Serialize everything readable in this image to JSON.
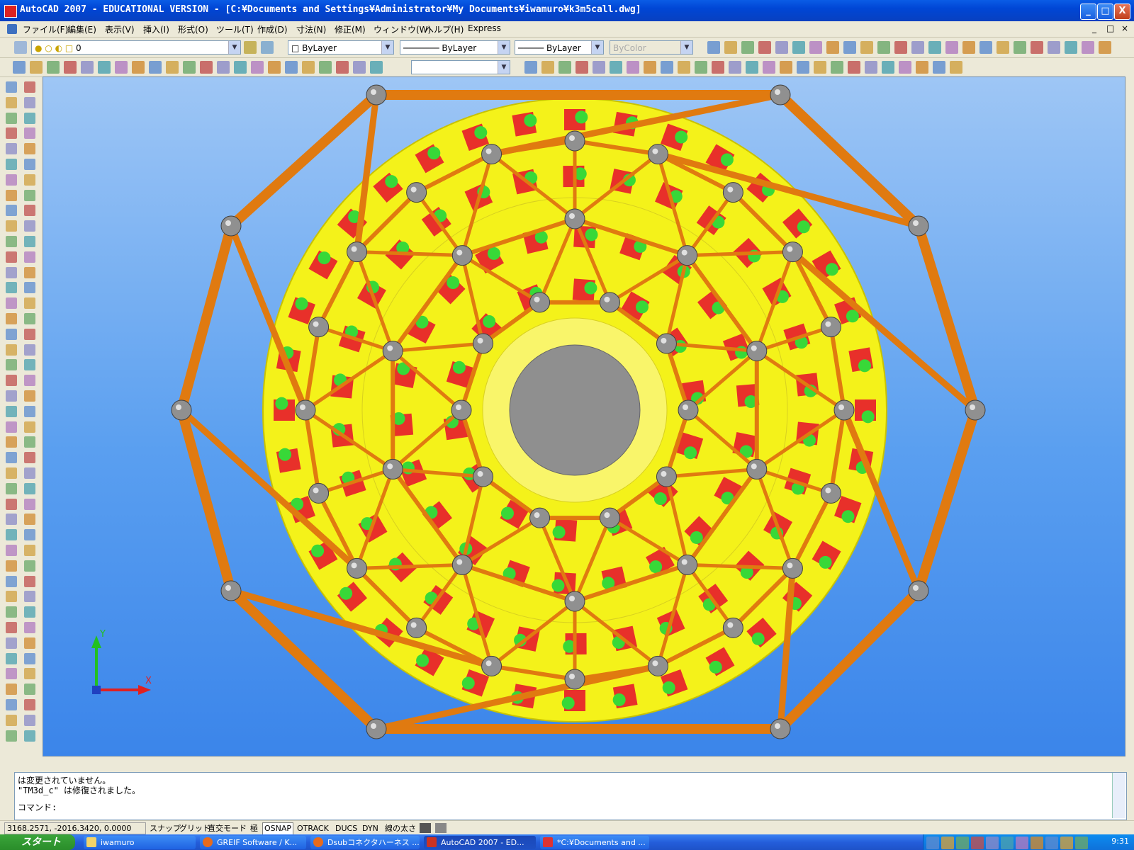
{
  "titlebar": {
    "title": "AutoCAD 2007 - EDUCATIONAL VERSION - [C:¥Documents and Settings¥Administrator¥My Documents¥iwamuro¥k3m5call.dwg]",
    "minimize": "_",
    "maximize": "□",
    "close": "X"
  },
  "menu": {
    "items": [
      "ファイル(F)",
      "編集(E)",
      "表示(V)",
      "挿入(I)",
      "形式(O)",
      "ツール(T)",
      "作成(D)",
      "寸法(N)",
      "修正(M)",
      "ウィンドウ(W)",
      "ヘルプ(H)",
      "Express"
    ],
    "doc_controls": [
      "_",
      "□",
      "×"
    ]
  },
  "properties_toolbar": {
    "layer_value": "0",
    "color_value": "ByLayer",
    "linetype_value": "ByLayer",
    "lineweight_value": "ByLayer",
    "plotstyle_value": "ByColor"
  },
  "colors": {
    "viewport_top": "#9ec6f5",
    "viewport_bottom": "#3b85ea",
    "frame_orange": "#e07a10",
    "disk_yellow": "#f4f21a",
    "module_red": "#e8302a",
    "module_green": "#38d838",
    "node_gray": "#909090",
    "center_gray": "#8f8f8f"
  },
  "ucs": {
    "x_label": "X",
    "y_label": "Y"
  },
  "command": {
    "history": [
      "は変更されていません。",
      "\"TM3d_c\" は修復されました。"
    ],
    "prompt": "コマンド:"
  },
  "status": {
    "coords": "3168.2571, -2016.3420, 0.0000",
    "buttons": [
      "スナップ",
      "グリッド",
      "直交モード",
      "極",
      "OSNAP",
      "OTRACK",
      "DUCS",
      "DYN",
      "線の太さ"
    ],
    "active": [
      "OSNAP"
    ]
  },
  "taskbar": {
    "start": "スタート",
    "items": [
      "iwamuro",
      "GREIF Software / K...",
      "Dsubコネクタハーネス ...",
      "AutoCAD 2007 - ED...",
      "*C:¥Documents and ..."
    ],
    "clock": "9:31"
  }
}
